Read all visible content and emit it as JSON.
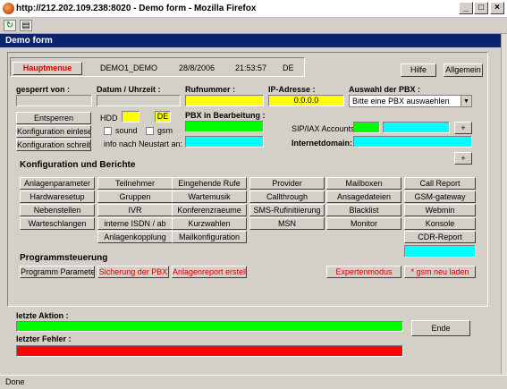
{
  "window": {
    "title": "http://212.202.109.238:8020 - Demo form - Mozilla Firefox",
    "page_title": "Demo form"
  },
  "header": {
    "main_menu": "Hauptmenue",
    "project": "DEMO1_DEMO",
    "date": "28/8/2006",
    "time": "21:53:57",
    "lang": "DE",
    "help": "Hilfe",
    "general": "Allgemein"
  },
  "fields": {
    "locked_by_label": "gesperrt von :",
    "datetime_label": "Datum / Uhrzeit :",
    "phone_label": "Rufnummer :",
    "ip_label": "IP-Adresse :",
    "ip_value": "0.0.0.0",
    "pbx_select_label": "Auswahl der PBX :",
    "pbx_select_value": "Bitte eine PBX auswaehlen",
    "pbx_editing_label": "PBX in Bearbeitung :",
    "sip_label": "SIP/IAX Accounts:",
    "internet_domain_label": "Internetdomain:",
    "hdd_label": "HDD",
    "de_value": "DE",
    "sound_label": "sound",
    "gsm_label": "gsm",
    "restart_info": "info nach Neustart an:"
  },
  "left_buttons": [
    "Entsperren",
    "Konfiguration einlesen",
    "Konfiguration schreiben"
  ],
  "sections": {
    "config": "Konfiguration und Berichte",
    "program": "Programmsteuerung",
    "last_action": "letzte Aktion :",
    "last_error": "letzter Fehler :"
  },
  "config_grid": {
    "c1": [
      "Anlagenparameter",
      "Hardwaresetup",
      "Nebenstellen",
      "Warteschlangen"
    ],
    "c2": [
      "Teilnehmer",
      "Gruppen",
      "IVR",
      "interne ISDN / ab",
      "Anlagenkopplung"
    ],
    "c3": [
      "Eingehende Rufe",
      "Wartemusik",
      "Konferenzraeume",
      "Kurzwahlen",
      "Mailkonfiguration"
    ],
    "c4": [
      "Provider",
      "Callthrough",
      "SMS-Rufinitiierung",
      "MSN"
    ],
    "c5": [
      "Mailboxen",
      "Ansagedateien",
      "Blacklist",
      "Monitor"
    ],
    "c6": [
      "Call Report",
      "GSM-gateway",
      "Webmin",
      "Konsole",
      "CDR-Report"
    ]
  },
  "program_buttons": {
    "params": "Programm Parameter",
    "backup": "Sicherung der PBX",
    "report": "Anlagenreport erstellen",
    "expert": "Expertenmodus",
    "gsm_reload": "* gsm neu laden"
  },
  "end_button": "Ende",
  "plus": "+",
  "status": "Done",
  "colors": {
    "yellow": "#ffff00",
    "green": "#00ff00",
    "cyan": "#00ffff",
    "red": "#ff0000",
    "blue_header": "#0a246a"
  }
}
